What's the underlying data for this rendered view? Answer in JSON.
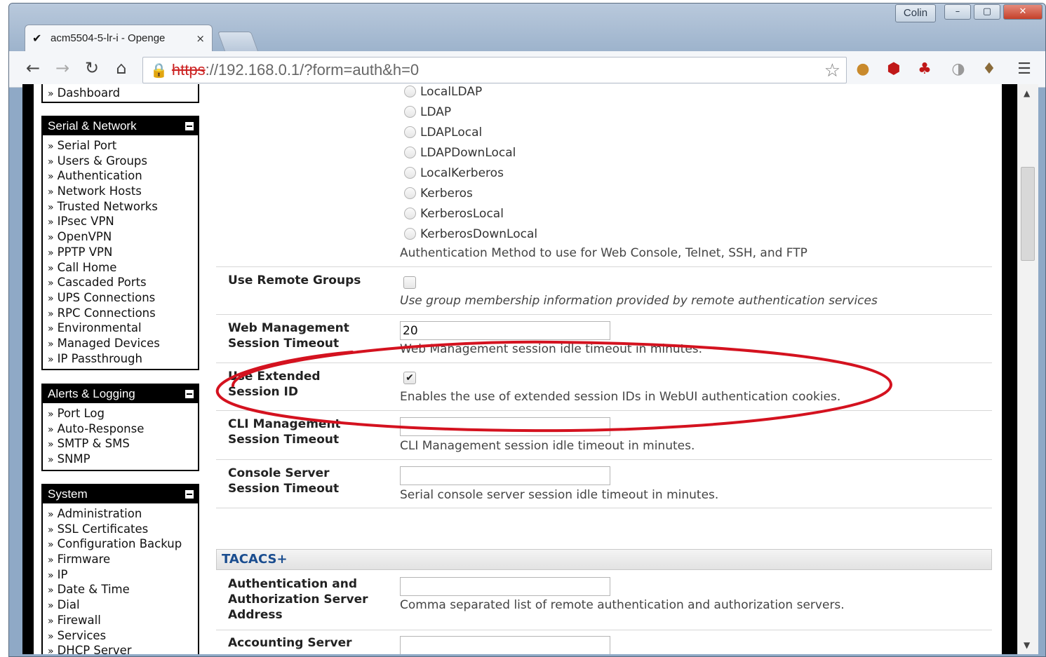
{
  "window": {
    "user_button": "Colin",
    "minimize": "–",
    "maximize": "▢",
    "close": "✕"
  },
  "tab": {
    "title": "acm5504-5-lr-i - Openge",
    "close": "×"
  },
  "address_bar": {
    "protocol": "https",
    "rest": "://192.168.0.1/?form=auth&h=0"
  },
  "sidebar": {
    "top_item": "Dashboard",
    "serial_network": {
      "title": "Serial & Network",
      "items": [
        "Serial Port",
        "Users & Groups",
        "Authentication",
        "Network Hosts",
        "Trusted Networks",
        "IPsec VPN",
        "OpenVPN",
        "PPTP VPN",
        "Call Home",
        "Cascaded Ports",
        "UPS Connections",
        "RPC Connections",
        "Environmental",
        "Managed Devices",
        "IP Passthrough"
      ]
    },
    "alerts_logging": {
      "title": "Alerts & Logging",
      "items": [
        "Port Log",
        "Auto-Response",
        "SMTP & SMS",
        "SNMP"
      ]
    },
    "system": {
      "title": "System",
      "items": [
        "Administration",
        "SSL Certificates",
        "Configuration Backup",
        "Firmware",
        "IP",
        "Date & Time",
        "Dial",
        "Firewall",
        "Services",
        "DHCP Server"
      ]
    }
  },
  "auth_methods": [
    "LocalLDAP",
    "LDAP",
    "LDAPLocal",
    "LDAPDownLocal",
    "LocalKerberos",
    "Kerberos",
    "KerberosLocal",
    "KerberosDownLocal"
  ],
  "auth_method_desc": "Authentication Method to use for Web Console, Telnet, SSH, and FTP",
  "remote_groups": {
    "label": "Use Remote Groups",
    "desc": "Use group membership information provided by remote authentication services"
  },
  "web_timeout": {
    "label1": "Web Management",
    "label2": "Session Timeout",
    "value": "20",
    "desc": "Web Management session idle timeout in minutes."
  },
  "extended_session": {
    "label1": "Use Extended",
    "label2": "Session ID",
    "desc": "Enables the use of extended session IDs in WebUI authentication cookies."
  },
  "cli_timeout": {
    "label1": "CLI Management",
    "label2": "Session Timeout",
    "value": "",
    "desc": "CLI Management session idle timeout in minutes."
  },
  "console_timeout": {
    "label1": "Console Server",
    "label2": "Session Timeout",
    "value": "",
    "desc": "Serial console server session idle timeout in minutes."
  },
  "tacacs": {
    "title": "TACACS+",
    "aa_label1": "Authentication and",
    "aa_label2": "Authorization Server",
    "aa_label3": "Address",
    "aa_value": "",
    "aa_desc": "Comma separated list of remote authentication and authorization servers.",
    "acct_label": "Accounting Server",
    "acct_value": ""
  },
  "colors": {
    "accent": "#1a4d8f",
    "annotation": "#d4121f"
  }
}
